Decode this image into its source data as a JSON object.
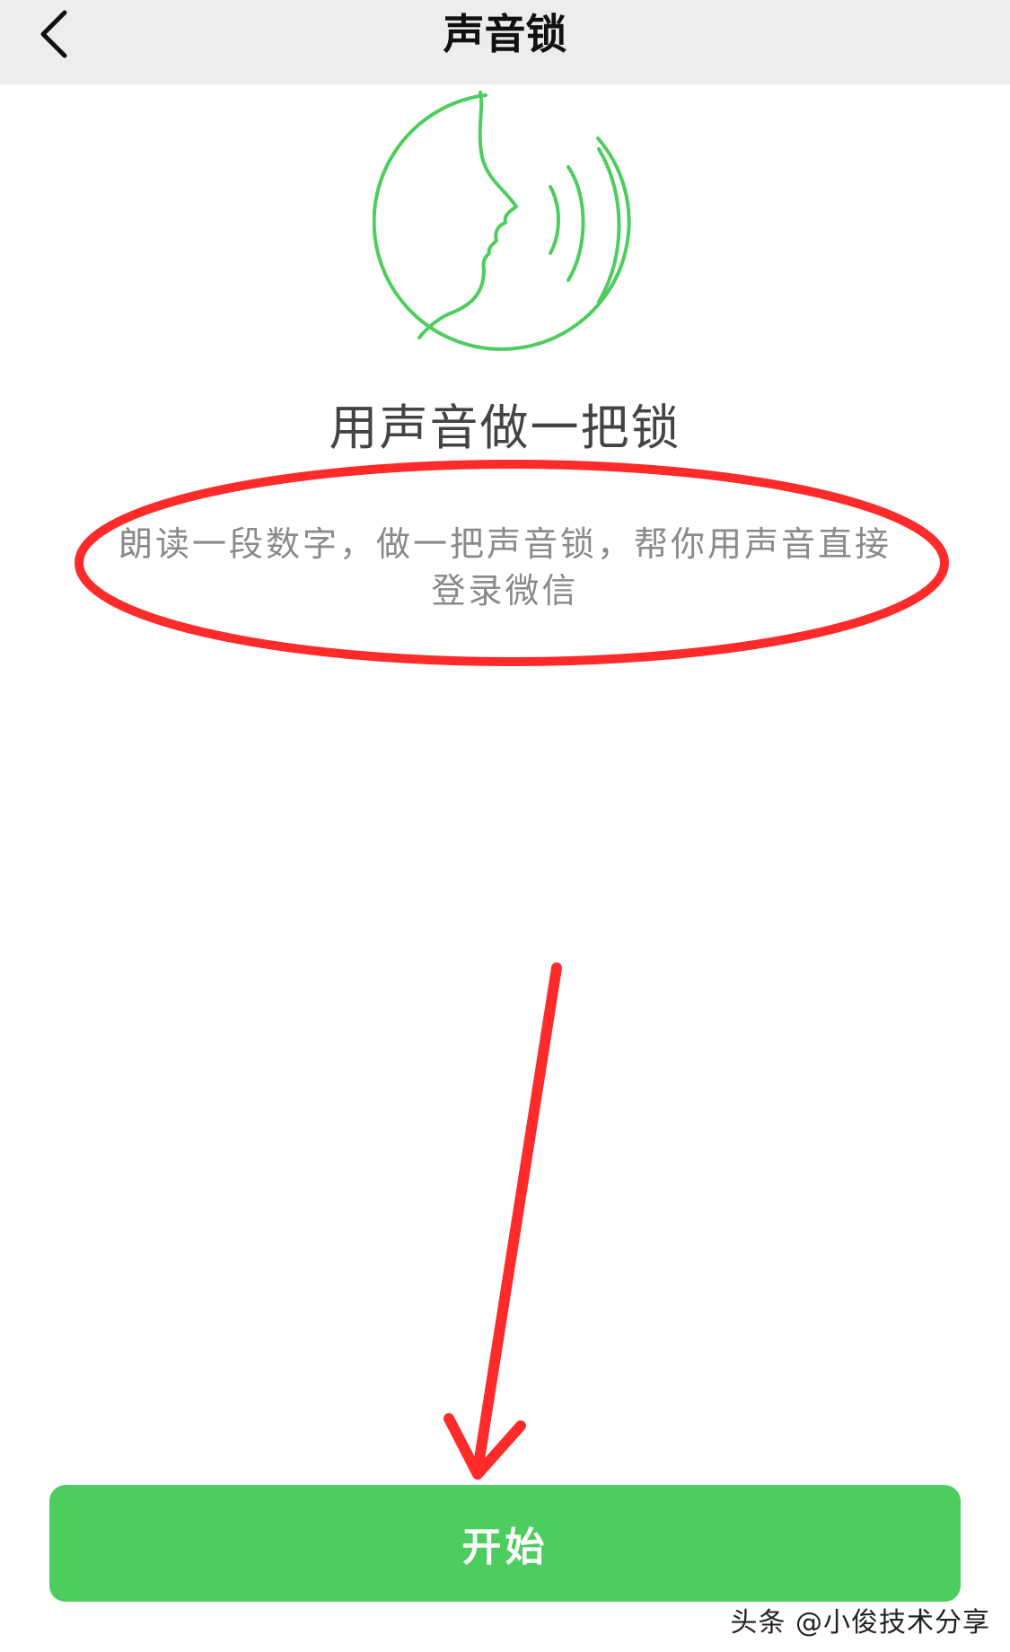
{
  "nav": {
    "back_icon": "chevron-left-icon",
    "title": "声音锁"
  },
  "hero": {
    "logo_icon": "speaking-face-icon",
    "logo_color": "#4ccd5e"
  },
  "content": {
    "headline": "用声音做一把锁",
    "description": "朗读一段数字，做一把声音锁，帮你用声音直接登录微信"
  },
  "actions": {
    "start_label": "开始",
    "start_color": "#4ccd5e"
  },
  "annotations": {
    "color": "#ff2a2a",
    "highlight": "ellipse-around-description",
    "pointer": "arrow-to-start-button"
  },
  "watermark": {
    "text": "头条 @小俊技术分享"
  }
}
